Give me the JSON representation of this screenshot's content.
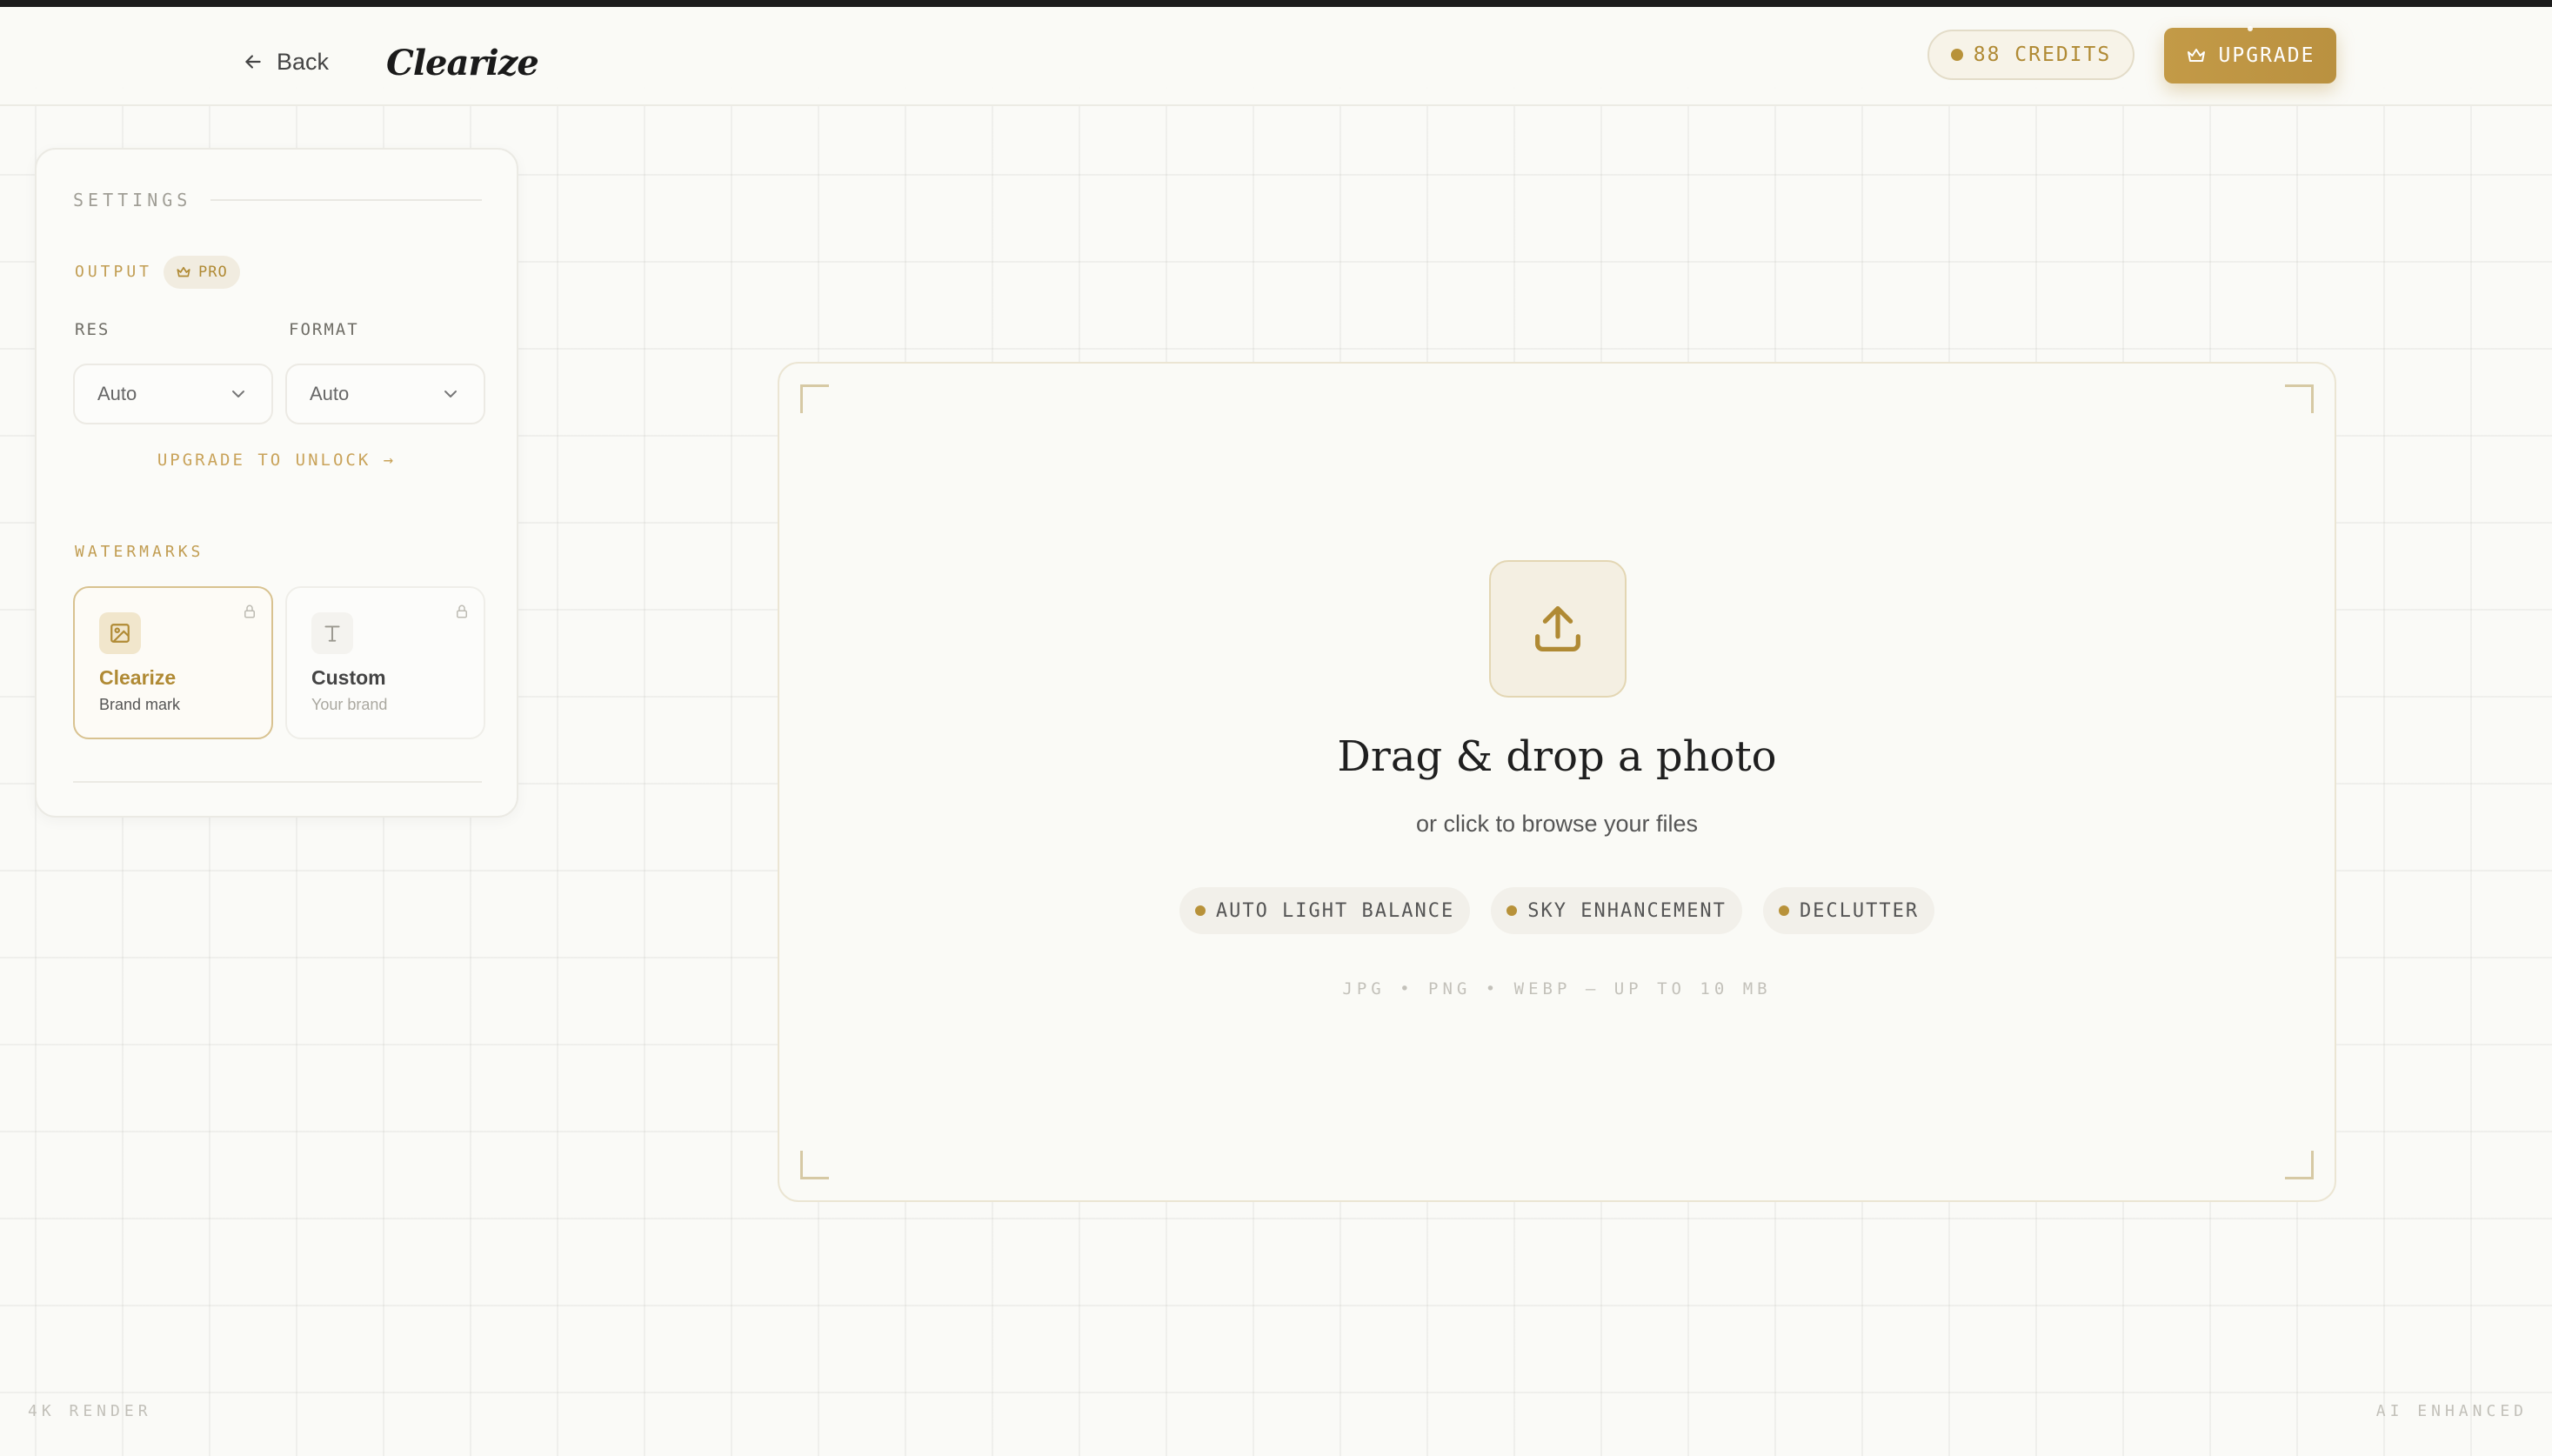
{
  "header": {
    "back_label": "Back",
    "logo": "Clearize",
    "credits_label": "88 CREDITS",
    "upgrade_label": "UPGRADE"
  },
  "sidebar": {
    "title": "SETTINGS",
    "output_label": "OUTPUT",
    "pro_badge": "PRO",
    "res_label": "RES",
    "format_label": "FORMAT",
    "res_value": "Auto",
    "format_value": "Auto",
    "unlock_link": "UPGRADE TO UNLOCK →",
    "watermarks_label": "WATERMARKS",
    "watermarks": [
      {
        "title": "Clearize",
        "subtitle": "Brand mark",
        "icon": "image-icon",
        "selected": true
      },
      {
        "title": "Custom",
        "subtitle": "Your brand",
        "icon": "text-icon",
        "selected": false
      }
    ]
  },
  "dropzone": {
    "title": "Drag & drop a photo",
    "subtitle": "or click to browse your files",
    "features": [
      "AUTO LIGHT BALANCE",
      "SKY ENHANCEMENT",
      "DECLUTTER"
    ],
    "formats": "JPG • PNG • WEBP — UP TO 10 MB"
  },
  "footer": {
    "left_label": "4K RENDER",
    "right_label": "AI ENHANCED"
  },
  "colors": {
    "accent": "#b8923a",
    "background": "#fafaf7",
    "header_bar": "#1c1c1c"
  }
}
